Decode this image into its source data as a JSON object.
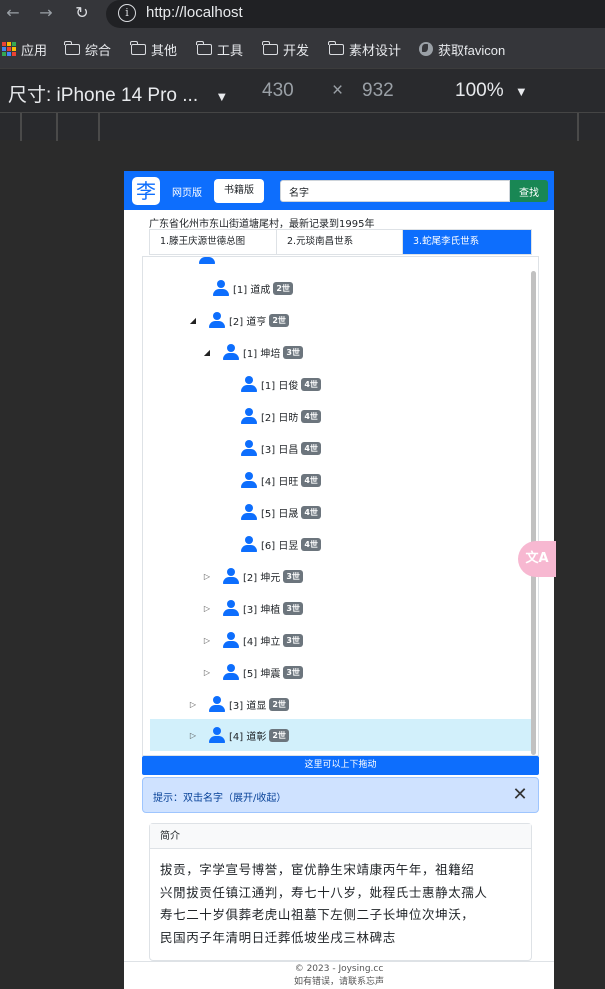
{
  "browser": {
    "url": "http://localhost",
    "bookmarks": [
      "应用",
      "综合",
      "其他",
      "工具",
      "开发",
      "素材设计",
      "获取favicon"
    ],
    "device_label": "尺寸: iPhone 14 Pro ...",
    "width": "430",
    "times": "×",
    "height": "932",
    "zoom": "100%"
  },
  "app": {
    "logo_char": "李",
    "mode_web": "网页版",
    "mode_book": "书籍版",
    "search_value": "名字",
    "search_button": "查找",
    "address": "广东省化州市东山街道塘尾村，最新记录到1995年",
    "tabs": [
      "1.滕王庆源世德总图",
      "2.元琰南昌世系",
      "3.蛇尾李氏世系"
    ],
    "tree": [
      {
        "label": "[1] 道成",
        "gen": "2世",
        "toggle": ""
      },
      {
        "label": "[2] 道亨",
        "gen": "2世",
        "toggle": "◢"
      },
      {
        "label": "[1] 坤培",
        "gen": "3世",
        "toggle": "◢"
      },
      {
        "label": "[1] 日俊",
        "gen": "4世",
        "toggle": ""
      },
      {
        "label": "[2] 日昉",
        "gen": "4世",
        "toggle": ""
      },
      {
        "label": "[3] 日昌",
        "gen": "4世",
        "toggle": ""
      },
      {
        "label": "[4] 日旺",
        "gen": "4世",
        "toggle": ""
      },
      {
        "label": "[5] 日晟",
        "gen": "4世",
        "toggle": ""
      },
      {
        "label": "[6] 日昱",
        "gen": "4世",
        "toggle": ""
      },
      {
        "label": "[2] 坤元",
        "gen": "3世",
        "toggle": "▷"
      },
      {
        "label": "[3] 坤植",
        "gen": "3世",
        "toggle": "▷"
      },
      {
        "label": "[4] 坤立",
        "gen": "3世",
        "toggle": "▷"
      },
      {
        "label": "[5] 坤震",
        "gen": "3世",
        "toggle": "▷"
      },
      {
        "label": "[3] 道显",
        "gen": "2世",
        "toggle": "▷"
      },
      {
        "label": "[4] 道彰",
        "gen": "2世",
        "toggle": "▷"
      }
    ],
    "drag_hint": "这里可以上下拖动",
    "hint": "提示：双击名字（展开/收起）",
    "intro_title": "简介",
    "intro_lines": [
      "拔贡，字学宣号博誉，宦优静生宋靖康丙午年，祖籍绍",
      "兴閒拔贡任镇江通判，寿七十八岁，妣程氏士惠静太孺人",
      "寿七二十岁俱葬老虎山祖墓下左侧二子长坤位次坤沃，",
      "民国丙子年清明日迁葬低坡坐戌三林碑志"
    ],
    "footer_line1": "© 2023 - Joysing.cc",
    "footer_line2": "如有错误，请联系忘声",
    "translate_icon": "文A",
    "colors": {
      "primary": "#0d6efd",
      "success": "#198754",
      "badge": "#6c757d",
      "hint_bg": "#cfe2ff"
    }
  }
}
